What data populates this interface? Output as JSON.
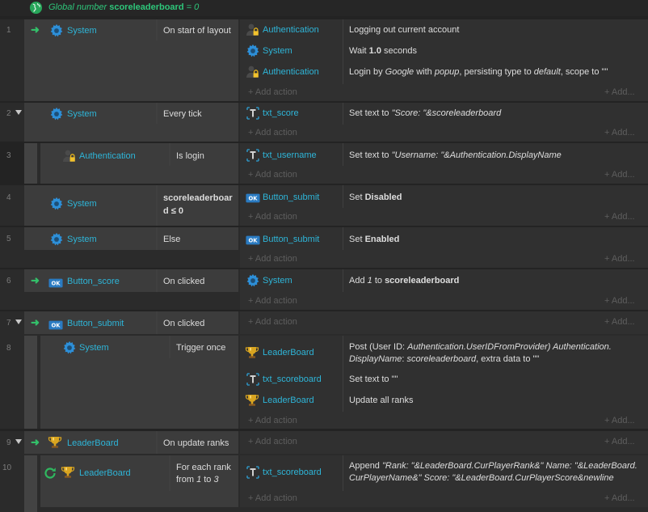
{
  "global": {
    "prefix": "Global number",
    "name": "scoreleaderboard",
    "suffix": "= 0"
  },
  "add_action_label": "+ Add action",
  "add_label": "+ Add...",
  "events": [
    {
      "num": "1",
      "condition_object": "System",
      "condition_text": "On start of layout",
      "actions": [
        {
          "object": "Authentication",
          "text": "Logging out current account"
        },
        {
          "object": "System",
          "text": "Wait 1.0 seconds"
        },
        {
          "object": "Authentication",
          "text": "Login by Google with popup, persisting type to default, scope to \"\""
        }
      ]
    },
    {
      "num": "2",
      "condition_object": "System",
      "condition_text": "Every tick",
      "actions": [
        {
          "object": "txt_score",
          "text": "Set text to \"Score: \"&scoreleaderboard"
        }
      ]
    },
    {
      "num": "3",
      "condition_object": "Authentication",
      "condition_text": "Is login",
      "actions": [
        {
          "object": "txt_username",
          "text": "Set text to \"Username: \"&Authentication.DisplayName"
        }
      ]
    },
    {
      "num": "4",
      "condition_object": "System",
      "condition_text": "scoreleaderboard ≤ 0",
      "actions": [
        {
          "object": "Button_submit",
          "text": "Set Disabled"
        }
      ]
    },
    {
      "num": "5",
      "condition_object": "System",
      "condition_text": "Else",
      "actions": [
        {
          "object": "Button_submit",
          "text": "Set Enabled"
        }
      ]
    },
    {
      "num": "6",
      "condition_object": "Button_score",
      "condition_text": "On clicked",
      "actions": [
        {
          "object": "System",
          "text": "Add 1 to scoreleaderboard"
        }
      ]
    },
    {
      "num": "7",
      "condition_object": "Button_submit",
      "condition_text": "On clicked",
      "actions": []
    },
    {
      "num": "8",
      "condition_object": "System",
      "condition_text": "Trigger once",
      "actions": [
        {
          "object": "LeaderBoard",
          "text": "Post (User ID: Authentication.UserIDFromProvider) Authentication.DisplayName: scoreleaderboard, extra data to \"\""
        },
        {
          "object": "txt_scoreboard",
          "text": "Set text to \"\""
        },
        {
          "object": "LeaderBoard",
          "text": "Update all ranks"
        }
      ]
    },
    {
      "num": "9",
      "condition_object": "LeaderBoard",
      "condition_text": "On update ranks",
      "actions": []
    },
    {
      "num": "10",
      "condition_object": "LeaderBoard",
      "condition_text": "For each rank from 1 to 3",
      "actions": [
        {
          "object": "txt_scoreboard",
          "text": "Append \"Rank: \"&LeaderBoard.CurPlayerRank&\" Name: \"&LeaderBoard.CurPlayerName&\" Score: \"&LeaderBoard.CurPlayerScore&newline"
        }
      ]
    }
  ]
}
